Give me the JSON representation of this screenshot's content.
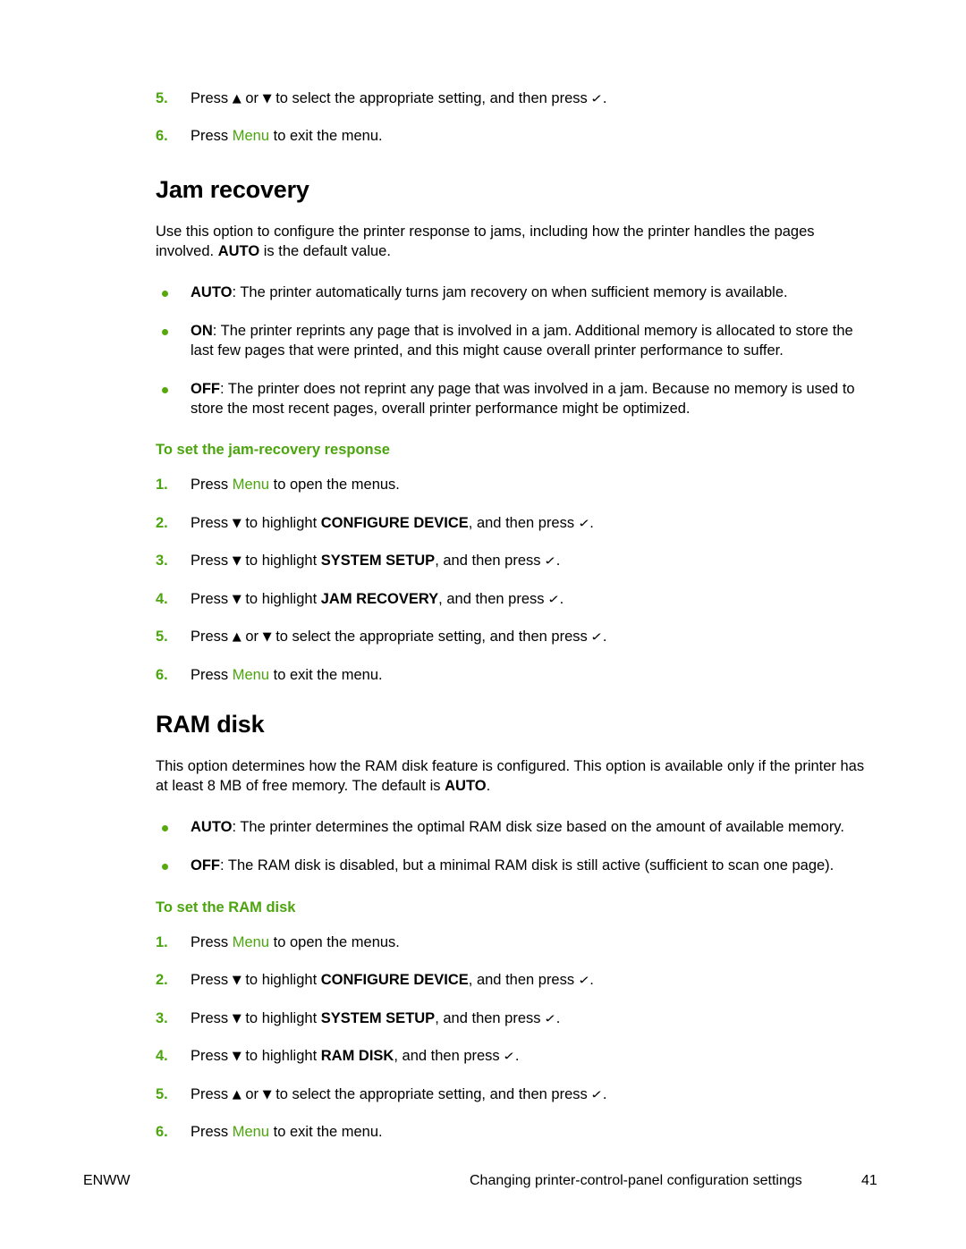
{
  "page": {
    "number": "41",
    "footer_locale": "ENWW",
    "footer_title": "Changing printer-control-panel configuration settings"
  },
  "glyphs": {
    "up_arrow": "▲",
    "down_arrow": "▼",
    "check": "✓",
    "bullet": "●"
  },
  "colors": {
    "accent_green": "#4ca50f",
    "bullet_green": "#57a80d",
    "text_black": "#000000",
    "page_background": "#ffffff"
  },
  "top_steps": [
    {
      "num": "5.",
      "parts": [
        {
          "t": "text",
          "v": "Press "
        },
        {
          "t": "glyph",
          "v": "▲"
        },
        {
          "t": "text",
          "v": " or "
        },
        {
          "t": "glyph",
          "v": "▼"
        },
        {
          "t": "text",
          "v": " to select the appropriate setting, and then press "
        },
        {
          "t": "check",
          "v": "✓"
        },
        {
          "t": "text",
          "v": "."
        }
      ]
    },
    {
      "num": "6.",
      "parts": [
        {
          "t": "text",
          "v": "Press "
        },
        {
          "t": "menu",
          "v": "Menu"
        },
        {
          "t": "text",
          "v": " to exit the menu."
        }
      ]
    }
  ],
  "sections": [
    {
      "id": "jam-recovery",
      "title": "Jam recovery",
      "intro": [
        {
          "t": "text",
          "v": "Use this option to configure the printer response to jams, including how the printer handles the pages involved. "
        },
        {
          "t": "kw",
          "v": "AUTO"
        },
        {
          "t": "text",
          "v": " is the default value."
        }
      ],
      "bullets": [
        {
          "parts": [
            {
              "t": "kw",
              "v": "AUTO"
            },
            {
              "t": "text",
              "v": ": The printer automatically turns jam recovery on when sufficient memory is available."
            }
          ]
        },
        {
          "parts": [
            {
              "t": "kw",
              "v": "ON"
            },
            {
              "t": "text",
              "v": ": The printer reprints any page that is involved in a jam. Additional memory is allocated to store the last few pages that were printed, and this might cause overall printer performance to suffer."
            }
          ]
        },
        {
          "parts": [
            {
              "t": "kw",
              "v": "OFF"
            },
            {
              "t": "text",
              "v": ": The printer does not reprint any page that was involved in a jam. Because no memory is used to store the most recent pages, overall printer performance might be optimized."
            }
          ]
        }
      ],
      "procedure_title": "To set the jam-recovery response",
      "steps": [
        {
          "num": "1.",
          "parts": [
            {
              "t": "text",
              "v": "Press "
            },
            {
              "t": "menu",
              "v": "Menu"
            },
            {
              "t": "text",
              "v": " to open the menus."
            }
          ]
        },
        {
          "num": "2.",
          "parts": [
            {
              "t": "text",
              "v": "Press "
            },
            {
              "t": "glyph",
              "v": "▼"
            },
            {
              "t": "text",
              "v": " to highlight "
            },
            {
              "t": "kw",
              "v": "CONFIGURE DEVICE"
            },
            {
              "t": "text",
              "v": ", and then press "
            },
            {
              "t": "check",
              "v": "✓"
            },
            {
              "t": "text",
              "v": "."
            }
          ]
        },
        {
          "num": "3.",
          "parts": [
            {
              "t": "text",
              "v": "Press "
            },
            {
              "t": "glyph",
              "v": "▼"
            },
            {
              "t": "text",
              "v": " to highlight "
            },
            {
              "t": "kw",
              "v": "SYSTEM SETUP"
            },
            {
              "t": "text",
              "v": ", and then press "
            },
            {
              "t": "check",
              "v": "✓"
            },
            {
              "t": "text",
              "v": "."
            }
          ]
        },
        {
          "num": "4.",
          "parts": [
            {
              "t": "text",
              "v": "Press "
            },
            {
              "t": "glyph",
              "v": "▼"
            },
            {
              "t": "text",
              "v": " to highlight "
            },
            {
              "t": "kw",
              "v": "JAM RECOVERY"
            },
            {
              "t": "text",
              "v": ", and then press "
            },
            {
              "t": "check",
              "v": "✓"
            },
            {
              "t": "text",
              "v": "."
            }
          ]
        },
        {
          "num": "5.",
          "parts": [
            {
              "t": "text",
              "v": "Press "
            },
            {
              "t": "glyph",
              "v": "▲"
            },
            {
              "t": "text",
              "v": " or "
            },
            {
              "t": "glyph",
              "v": "▼"
            },
            {
              "t": "text",
              "v": " to select the appropriate setting, and then press "
            },
            {
              "t": "check",
              "v": "✓"
            },
            {
              "t": "text",
              "v": "."
            }
          ]
        },
        {
          "num": "6.",
          "parts": [
            {
              "t": "text",
              "v": "Press "
            },
            {
              "t": "menu",
              "v": "Menu"
            },
            {
              "t": "text",
              "v": " to exit the menu."
            }
          ]
        }
      ]
    },
    {
      "id": "ram-disk",
      "title": "RAM disk",
      "intro": [
        {
          "t": "text",
          "v": "This option determines how the RAM disk feature is configured. This option is available only if the printer has at least 8 MB of free memory. The default is "
        },
        {
          "t": "kw",
          "v": "AUTO"
        },
        {
          "t": "text",
          "v": "."
        }
      ],
      "bullets": [
        {
          "parts": [
            {
              "t": "kw",
              "v": "AUTO"
            },
            {
              "t": "text",
              "v": ": The printer determines the optimal RAM disk size based on the amount of available memory."
            }
          ]
        },
        {
          "parts": [
            {
              "t": "kw",
              "v": "OFF"
            },
            {
              "t": "text",
              "v": ": The RAM disk is disabled, but a minimal RAM disk is still active (sufficient to scan one page)."
            }
          ]
        }
      ],
      "procedure_title": "To set the RAM disk",
      "steps": [
        {
          "num": "1.",
          "parts": [
            {
              "t": "text",
              "v": "Press "
            },
            {
              "t": "menu",
              "v": "Menu"
            },
            {
              "t": "text",
              "v": " to open the menus."
            }
          ]
        },
        {
          "num": "2.",
          "parts": [
            {
              "t": "text",
              "v": "Press "
            },
            {
              "t": "glyph",
              "v": "▼"
            },
            {
              "t": "text",
              "v": " to highlight "
            },
            {
              "t": "kw",
              "v": "CONFIGURE DEVICE"
            },
            {
              "t": "text",
              "v": ", and then press "
            },
            {
              "t": "check",
              "v": "✓"
            },
            {
              "t": "text",
              "v": "."
            }
          ]
        },
        {
          "num": "3.",
          "parts": [
            {
              "t": "text",
              "v": "Press "
            },
            {
              "t": "glyph",
              "v": "▼"
            },
            {
              "t": "text",
              "v": " to highlight "
            },
            {
              "t": "kw",
              "v": "SYSTEM SETUP"
            },
            {
              "t": "text",
              "v": ", and then press "
            },
            {
              "t": "check",
              "v": "✓"
            },
            {
              "t": "text",
              "v": "."
            }
          ]
        },
        {
          "num": "4.",
          "parts": [
            {
              "t": "text",
              "v": "Press "
            },
            {
              "t": "glyph",
              "v": "▼"
            },
            {
              "t": "text",
              "v": " to highlight "
            },
            {
              "t": "kw",
              "v": "RAM DISK"
            },
            {
              "t": "text",
              "v": ", and then press "
            },
            {
              "t": "check",
              "v": "✓"
            },
            {
              "t": "text",
              "v": "."
            }
          ]
        },
        {
          "num": "5.",
          "parts": [
            {
              "t": "text",
              "v": "Press "
            },
            {
              "t": "glyph",
              "v": "▲"
            },
            {
              "t": "text",
              "v": " or "
            },
            {
              "t": "glyph",
              "v": "▼"
            },
            {
              "t": "text",
              "v": " to select the appropriate setting, and then press "
            },
            {
              "t": "check",
              "v": "✓"
            },
            {
              "t": "text",
              "v": "."
            }
          ]
        },
        {
          "num": "6.",
          "parts": [
            {
              "t": "text",
              "v": "Press "
            },
            {
              "t": "menu",
              "v": "Menu"
            },
            {
              "t": "text",
              "v": " to exit the menu."
            }
          ]
        }
      ]
    }
  ]
}
